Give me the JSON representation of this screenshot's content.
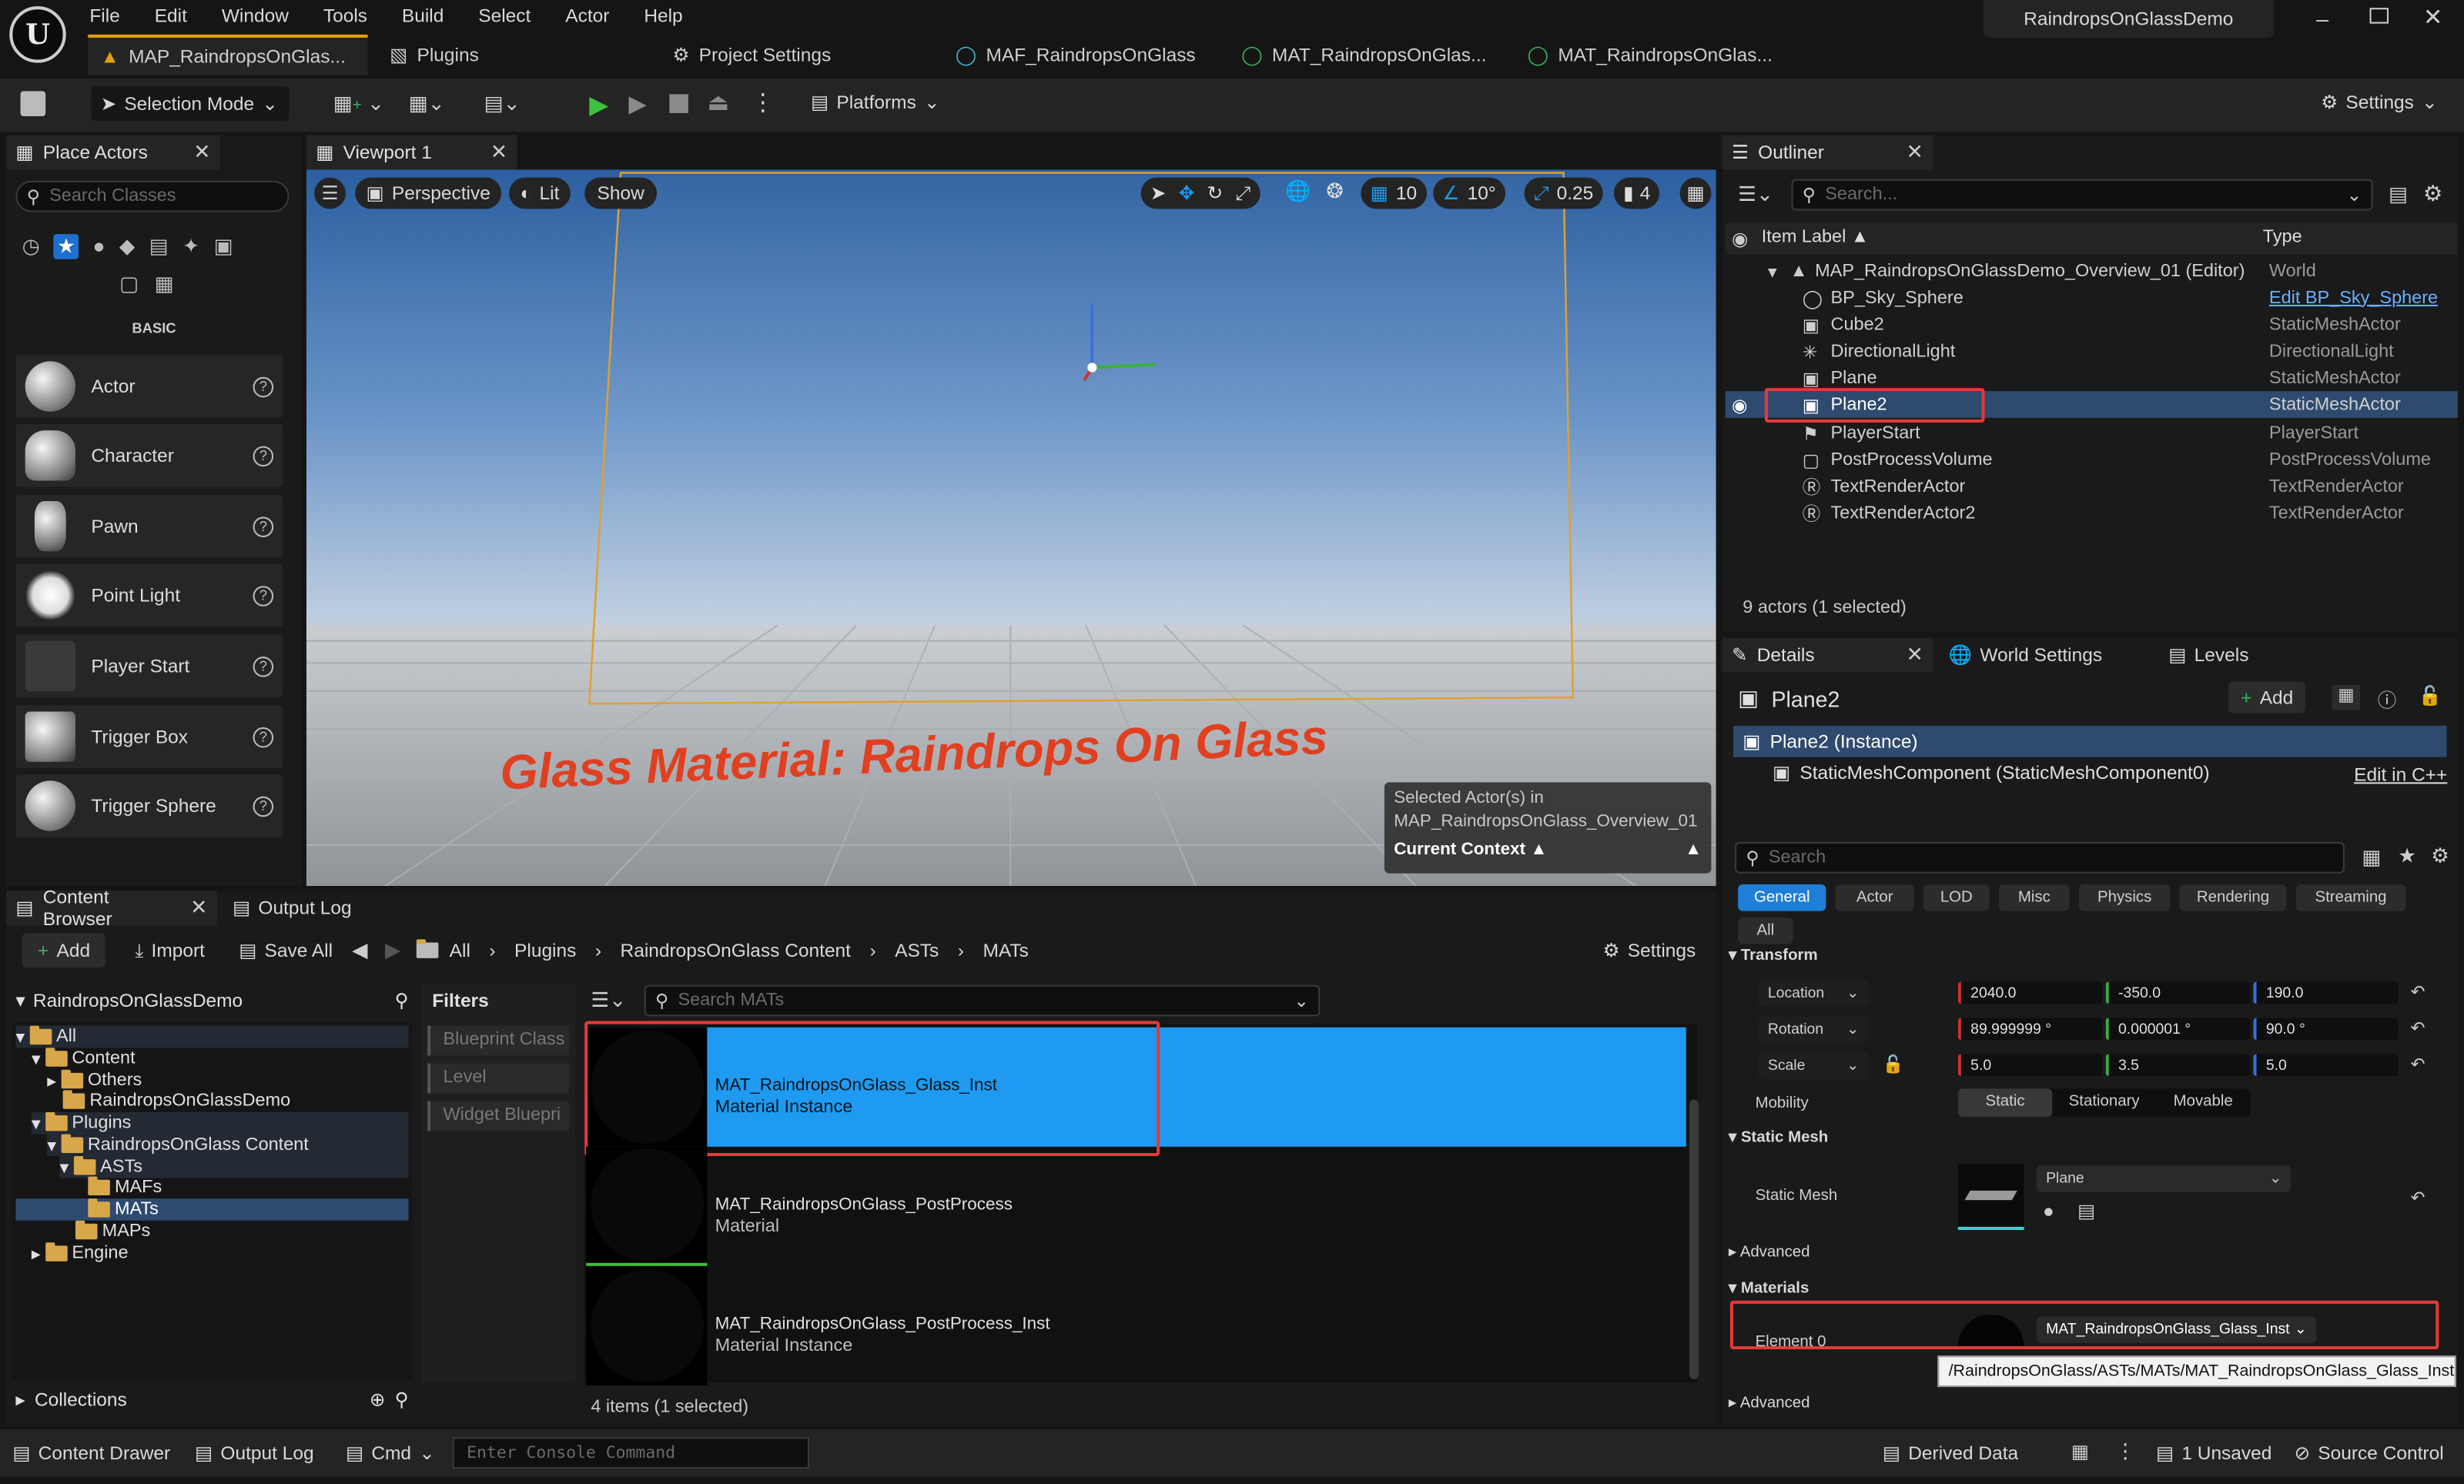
{
  "menu": [
    "File",
    "Edit",
    "Window",
    "Tools",
    "Build",
    "Select",
    "Actor",
    "Help"
  ],
  "window_title": "RaindropsOnGlassDemo",
  "doc_tabs": [
    {
      "label": "MAP_RaindropsOnGlas...",
      "active": true
    },
    {
      "label": "Plugins"
    },
    {
      "label": "Project Settings"
    },
    {
      "label": "MAF_RaindropsOnGlass"
    },
    {
      "label": "MAT_RaindropsOnGlas..."
    },
    {
      "label": "MAT_RaindropsOnGlas..."
    }
  ],
  "toolbar": {
    "selection_mode": "Selection Mode",
    "platforms": "Platforms",
    "settings": "Settings"
  },
  "place_actors": {
    "tab": "Place Actors",
    "search_placeholder": "Search Classes",
    "section": "BASIC",
    "items": [
      "Actor",
      "Character",
      "Pawn",
      "Point Light",
      "Player Start",
      "Trigger Box",
      "Trigger Sphere"
    ]
  },
  "viewport": {
    "tab": "Viewport 1",
    "perspective": "Perspective",
    "lit": "Lit",
    "show": "Show",
    "grid": "10",
    "angle": "10°",
    "scale": "0.25",
    "cam": "4",
    "overlay_text": "Glass Material: Raindrops On Glass",
    "context_line1": "Selected Actor(s) in",
    "context_line2": "MAP_RaindropsOnGlass_Overview_01",
    "context_label": "Current Context"
  },
  "outliner": {
    "tab": "Outliner",
    "search_placeholder": "Search...",
    "col_label": "Item Label",
    "col_type": "Type",
    "root": {
      "label": "MAP_RaindropsOnGlassDemo_Overview_01 (Editor)",
      "type": "World"
    },
    "rows": [
      {
        "label": "BP_Sky_Sphere",
        "type": "Edit BP_Sky_Sphere"
      },
      {
        "label": "Cube2",
        "type": "StaticMeshActor"
      },
      {
        "label": "DirectionalLight",
        "type": "DirectionalLight"
      },
      {
        "label": "Plane",
        "type": "StaticMeshActor"
      },
      {
        "label": "Plane2",
        "type": "StaticMeshActor"
      },
      {
        "label": "PlayerStart",
        "type": "PlayerStart"
      },
      {
        "label": "PostProcessVolume",
        "type": "PostProcessVolume"
      },
      {
        "label": "TextRenderActor",
        "type": "TextRenderActor"
      },
      {
        "label": "TextRenderActor2",
        "type": "TextRenderActor"
      }
    ],
    "status": "9 actors (1 selected)"
  },
  "details": {
    "tabs": [
      "Details",
      "World Settings",
      "Levels"
    ],
    "actor": "Plane2",
    "add": "Add",
    "instance": "Plane2 (Instance)",
    "component": "StaticMeshComponent (StaticMeshComponent0)",
    "edit_cpp": "Edit in C++",
    "search_placeholder": "Search",
    "categories": [
      "General",
      "Actor",
      "LOD",
      "Misc",
      "Physics",
      "Rendering",
      "Streaming",
      "All"
    ],
    "transform_section": "Transform",
    "location": {
      "label": "Location",
      "x": "2040.0",
      "y": "-350.0",
      "z": "190.0"
    },
    "rotation": {
      "label": "Rotation",
      "x": "89.999999 °",
      "y": "0.000001 °",
      "z": "90.0 °"
    },
    "scale": {
      "label": "Scale",
      "x": "5.0",
      "y": "3.5",
      "z": "5.0"
    },
    "mobility": {
      "label": "Mobility",
      "options": [
        "Static",
        "Stationary",
        "Movable"
      ]
    },
    "static_mesh_section": "Static Mesh",
    "static_mesh_label": "Static Mesh",
    "static_mesh_value": "Plane",
    "advanced": "Advanced",
    "materials_section": "Materials",
    "element0": "Element 0",
    "material_value": "MAT_RaindropsOnGlass_Glass_Inst",
    "tooltip": "/RaindropsOnGlass/ASTs/MATs/MAT_RaindropsOnGlass_Glass_Inst",
    "advanced2": "Advanced"
  },
  "content_browser": {
    "tab": "Content Browser",
    "tab2": "Output Log",
    "add": "Add",
    "import": "Import",
    "save_all": "Save All",
    "breadcrumb": [
      "All",
      "Plugins",
      "RaindropsOnGlass Content",
      "ASTs",
      "MATs"
    ],
    "settings": "Settings",
    "project": "RaindropsOnGlassDemo",
    "tree": [
      "All",
      "Content",
      "Others",
      "RaindropsOnGlassDemo",
      "Plugins",
      "RaindropsOnGlass Content",
      "ASTs",
      "MAFs",
      "MATs",
      "MAPs",
      "Engine"
    ],
    "filters_title": "Filters",
    "filters": [
      "Blueprint Class",
      "Level",
      "Widget Bluepri"
    ],
    "search_placeholder": "Search MATs",
    "assets": [
      {
        "name": "MAT_RaindropsOnGlass_Glass_Inst",
        "type": "Material Instance"
      },
      {
        "name": "MAT_RaindropsOnGlass_PostProcess",
        "type": "Material"
      },
      {
        "name": "MAT_RaindropsOnGlass_PostProcess_Inst",
        "type": "Material Instance"
      }
    ],
    "status": "4 items (1 selected)",
    "collections": "Collections"
  },
  "statusbar": {
    "content_drawer": "Content Drawer",
    "output_log": "Output Log",
    "cmd": "Cmd",
    "console_placeholder": "Enter Console Command",
    "derived_data": "Derived Data",
    "unsaved": "1 Unsaved",
    "source_control": "Source Control"
  },
  "colors": {
    "accent": "#1e9bf0",
    "highlight": "#2e4a6e",
    "red_box": "#e23a3a",
    "bg": "#151515"
  }
}
